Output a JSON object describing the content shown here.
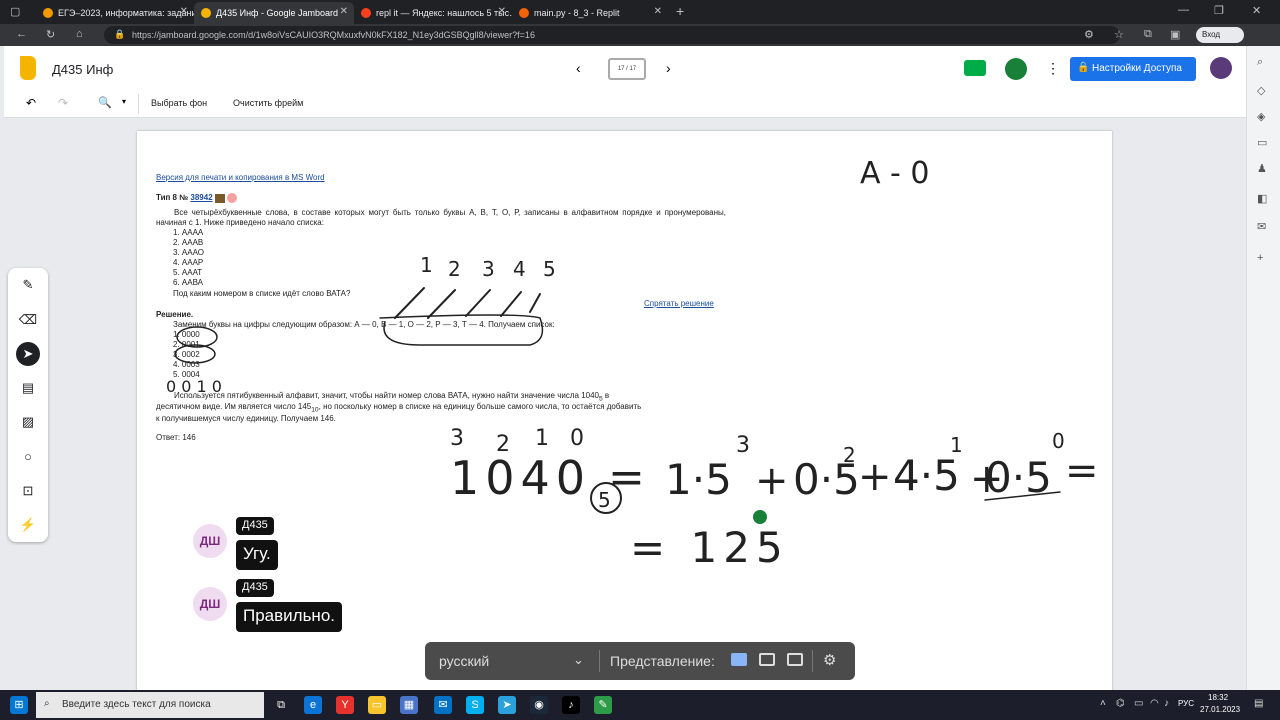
{
  "browser": {
    "tabs": [
      {
        "title": "ЕГЭ–2023, информатика: задани…",
        "active": false,
        "color": "#f29900"
      },
      {
        "title": "Д435 Инф - Google Jamboard",
        "active": true,
        "color": "#f5b400"
      },
      {
        "title": "repl it — Яндекс: нашлось 5 тыс…",
        "active": false,
        "color": "#fc3f1d"
      },
      {
        "title": "main.py - 8_3 - Replit",
        "active": false,
        "color": "#f26207"
      }
    ],
    "new_tab": "+",
    "url": "https://jamboard.google.com/d/1w8oiVsCAUIO3RQMxuxfvN0kFX182_N1ey3dGSBQgll8/viewer?f=16",
    "login_label": "Вход"
  },
  "app": {
    "title": "Д435 Инф",
    "frame_counter": "17 / 17",
    "share_label": "Настройки Доступа",
    "toolbar": {
      "set_background": "Выбрать фон",
      "clear_frame": "Очистить фрейм"
    }
  },
  "task": {
    "print_link": "Версия для печати и копирования в MS Word",
    "type_label": "Тип 8 №",
    "task_number": "38942",
    "text": "Все четырёхбуквенные слова, в составе которых могут быть только буквы А, В, Т, О, Р, записаны в алфавитном порядке и пронумерованы, начиная с 1. Ниже приведено начало списка:",
    "list": [
      "1. АААА",
      "2. АААВ",
      "3. АААО",
      "4. АААР",
      "5. АААТ",
      "6. ААВА"
    ],
    "question": "Под каким номером в списке идёт слово ВАТА?",
    "hide_solution": "Спрятать решение",
    "solution_title": "Решение.",
    "solution_line": "Заменим буквы на цифры следующим образом: А — 0, В — 1, О — 2, Р — 3, Т — 4. Получаем список:",
    "solution_list": [
      "1. 0000",
      "2. 0001",
      "3. 0002",
      "4. 0003",
      "5. 0004"
    ],
    "solution_p1": "Используется пятибуквенный алфавит, значит, чтобы найти номер слова ВАТА, нужно найти значение числа 1040",
    "solution_p1_sub": "5",
    "solution_p1_end": " в",
    "solution_p2": "десятичном виде. Им является число 145",
    "solution_p2_sub": "10",
    "solution_p2_end": ", но поскольку номер в списке на единицу больше самого числа, то остаётся добавить",
    "solution_p3": "к получившемуся числу единицу. Получаем 146.",
    "answer": "Ответ: 146"
  },
  "handwriting": {
    "top_note": "A - 0",
    "digits_top": [
      "1",
      "2",
      "3",
      "4",
      "5"
    ],
    "number_note": "0 0 1 0",
    "powers": [
      "3",
      "2",
      "1",
      "0"
    ],
    "equation_left": "1040",
    "base": "5",
    "equation_right_terms": [
      "1·5",
      "0·5",
      "4·5",
      "0·5"
    ],
    "term_powers": [
      "3",
      "2",
      "1",
      "0"
    ],
    "result": "= 125"
  },
  "chat": [
    {
      "avatar": "ДШ",
      "name": "Д435",
      "message": "Угу."
    },
    {
      "avatar": "ДШ",
      "name": "Д435",
      "message": "Правильно."
    }
  ],
  "captions": {
    "language": "русский",
    "view_label": "Представление:"
  },
  "taskbar": {
    "search_placeholder": "Введите здесь текст для поиска",
    "lang": "РУС",
    "time": "18:32",
    "date": "27.01.2023"
  }
}
